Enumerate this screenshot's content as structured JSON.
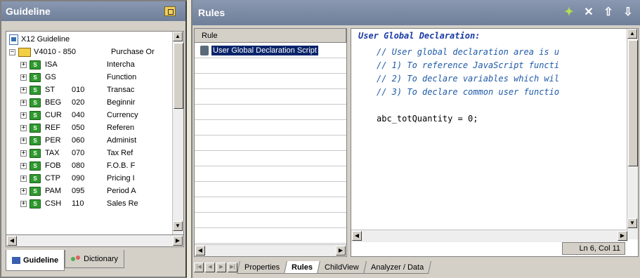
{
  "guideline_panel": {
    "title": "Guideline",
    "tree": {
      "root": "X12 Guideline",
      "doc": {
        "name": "V4010 - 850",
        "desc": "Purchase Or"
      },
      "segments": [
        {
          "name": "ISA",
          "num": "",
          "desc": "Intercha"
        },
        {
          "name": "GS",
          "num": "",
          "desc": "Function"
        },
        {
          "name": "ST",
          "num": "010",
          "desc": "Transac"
        },
        {
          "name": "BEG",
          "num": "020",
          "desc": "Beginnir"
        },
        {
          "name": "CUR",
          "num": "040",
          "desc": "Currency"
        },
        {
          "name": "REF",
          "num": "050",
          "desc": "Referen"
        },
        {
          "name": "PER",
          "num": "060",
          "desc": "Administ"
        },
        {
          "name": "TAX",
          "num": "070",
          "desc": "Tax Ref"
        },
        {
          "name": "FOB",
          "num": "080",
          "desc": "F.O.B. F"
        },
        {
          "name": "CTP",
          "num": "090",
          "desc": "Pricing I"
        },
        {
          "name": "PAM",
          "num": "095",
          "desc": "Period A"
        },
        {
          "name": "CSH",
          "num": "110",
          "desc": "Sales Re"
        }
      ]
    },
    "tabs": [
      "Guideline",
      "Dictionary"
    ]
  },
  "rules_panel": {
    "title": "Rules",
    "list_header": "Rule",
    "selected_rule": "User Global Declaration Script",
    "editor": {
      "heading": "User Global Declaration:",
      "comment_lines": [
        "// User global declaration area is u",
        "// 1) To reference JavaScript functi",
        "// 2) To declare variables which wil",
        "// 3) To declare common user functio"
      ],
      "code_var": "abc_totQuantity",
      "code_rest": " = 0;"
    },
    "status": "Ln 6, Col 11",
    "bottom_tabs": [
      "Properties",
      "Rules",
      "ChildView",
      "Analyzer / Data"
    ]
  }
}
